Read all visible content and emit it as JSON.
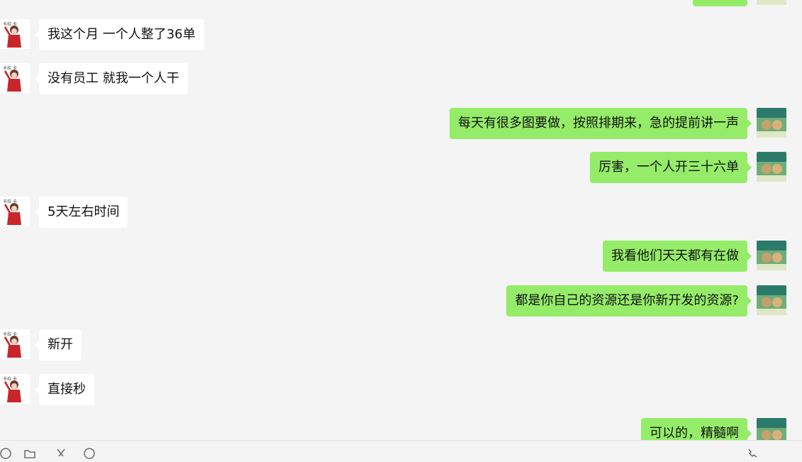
{
  "colors": {
    "background": "#f4f4f4",
    "incoming_bubble": "#ffffff",
    "outgoing_bubble": "#95ec69",
    "text": "#111111"
  },
  "messages": [
    {
      "side": "right",
      "text": ""
    },
    {
      "side": "left",
      "text": "我这个月 一个人整了36单"
    },
    {
      "side": "left",
      "text": "没有员工 就我一个人干"
    },
    {
      "side": "right",
      "text": "每天有很多图要做，按照排期来，急的提前讲一声"
    },
    {
      "side": "right",
      "text": "厉害，一个人开三十六单"
    },
    {
      "side": "left",
      "text": "5天左右时间"
    },
    {
      "side": "right",
      "text": "我看他们天天都有在做"
    },
    {
      "side": "right",
      "text": "都是你自己的资源还是你新开发的资源?"
    },
    {
      "side": "left",
      "text": "新开"
    },
    {
      "side": "left",
      "text": "直接秒"
    },
    {
      "side": "right",
      "text": "可以的，精髓啊"
    }
  ],
  "toolbar": {
    "icons": [
      "emoji-icon",
      "folder-icon",
      "scissors-icon",
      "chat-history-icon",
      "call-icon"
    ]
  }
}
